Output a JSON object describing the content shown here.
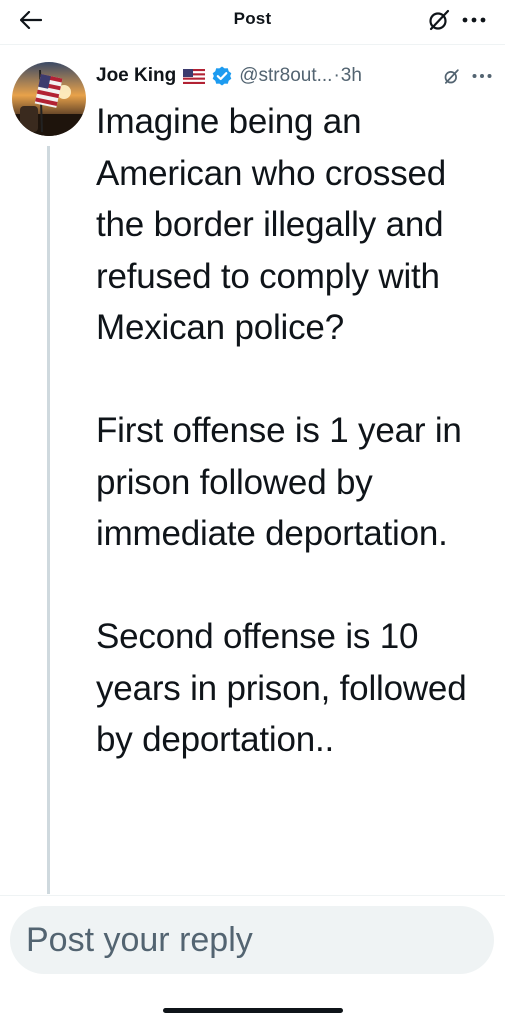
{
  "header": {
    "title": "Post",
    "back_icon": "arrow-left-icon",
    "grok_icon": "grok-icon",
    "more_icon": "more-horizontal-icon"
  },
  "post": {
    "author_name": "Joe King",
    "flag_icon": "us-flag-icon",
    "verified_icon": "verified-badge-icon",
    "verified_color": "#1d9bf0",
    "handle": "@str8out...",
    "separator": "·",
    "time": "3h",
    "text": "Imagine being an American who crossed the border illegally and refused to comply with Mexican police?\n\nFirst offense is 1 year in prison followed by immediate deportation.\n\nSecond offense is 10 years in prison, followed by deportation.."
  },
  "reply": {
    "placeholder": "Post your reply"
  },
  "colors": {
    "text_primary": "#0f1419",
    "text_secondary": "#536471",
    "divider": "#eff3f4",
    "thread_line": "#cfd9de",
    "reply_bg": "#eff3f4"
  }
}
